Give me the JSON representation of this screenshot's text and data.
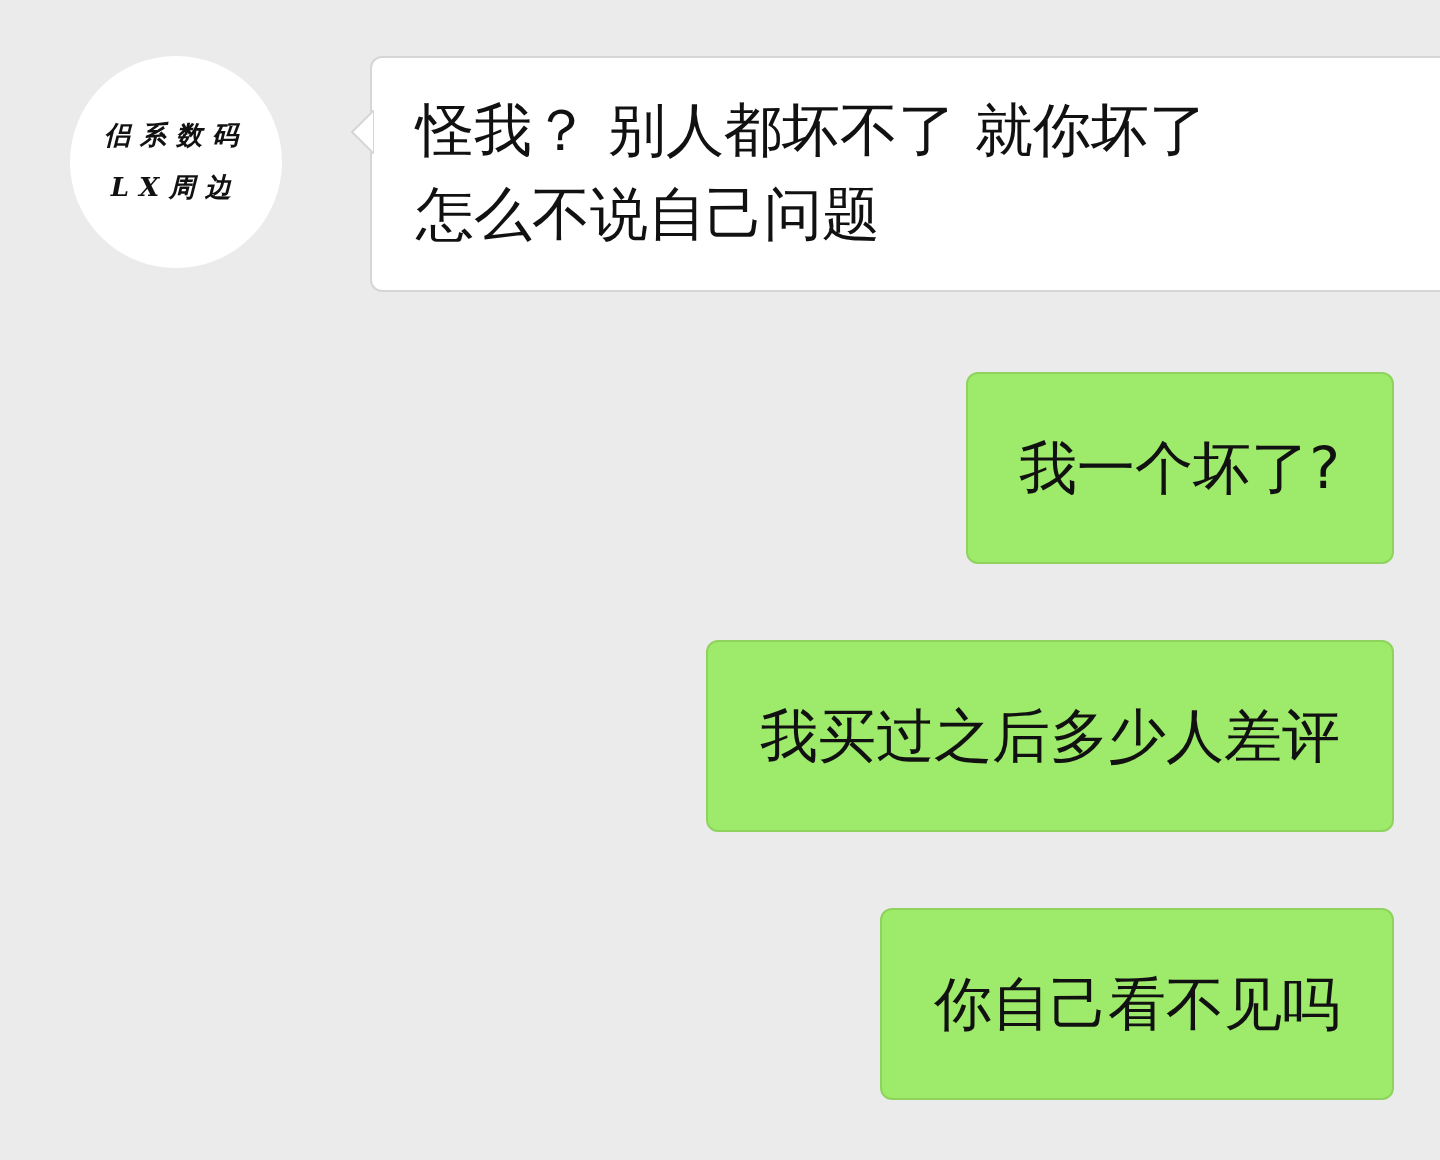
{
  "messages": [
    {
      "kind": "incoming",
      "avatar_lines": [
        "侣系数码",
        "LX周边"
      ],
      "lines": [
        "怪我？ 别人都坏不了 就你坏了",
        "怎么不说自己问题"
      ]
    },
    {
      "kind": "outgoing",
      "lines": [
        "我一个坏了?"
      ]
    },
    {
      "kind": "outgoing",
      "lines": [
        "我买过之后多少人差评"
      ]
    },
    {
      "kind": "outgoing",
      "lines": [
        "你自己看不见吗"
      ]
    }
  ]
}
